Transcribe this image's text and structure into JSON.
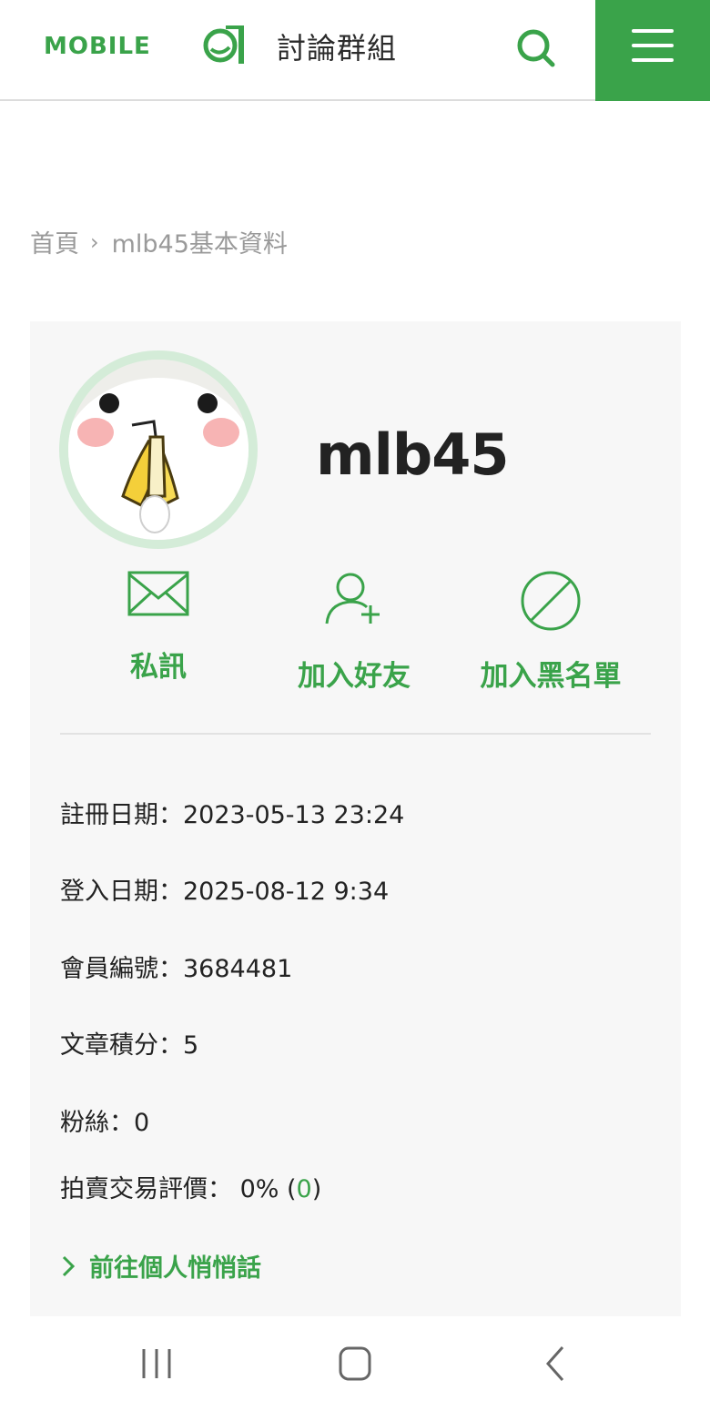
{
  "header": {
    "logo_text": "MOBILE01",
    "site_title": "討論群組"
  },
  "breadcrumb": {
    "home": "首頁",
    "separator": "›",
    "current": "mlb45基本資料"
  },
  "profile": {
    "username": "mlb45",
    "actions": [
      {
        "label": "私訊",
        "icon": "envelope-icon"
      },
      {
        "label": "加入好友",
        "icon": "add-friend-icon"
      },
      {
        "label": "加入黑名單",
        "icon": "block-icon"
      }
    ],
    "info": {
      "register": "註冊日期：2023-05-13 23:24",
      "login": "登入日期：2025-08-12 9:34",
      "member_no": "會員編號：3684481",
      "points": "文章積分：5",
      "fans": "粉絲：0",
      "rating_prefix": "拍賣交易評價： 0% (",
      "rating_count": "0",
      "rating_suffix": ")"
    },
    "link": "前往個人悄悄話"
  },
  "colors": {
    "accent": "#3aa34a",
    "card_bg": "#f7f7f7",
    "breadcrumb": "#9a9a9a"
  }
}
